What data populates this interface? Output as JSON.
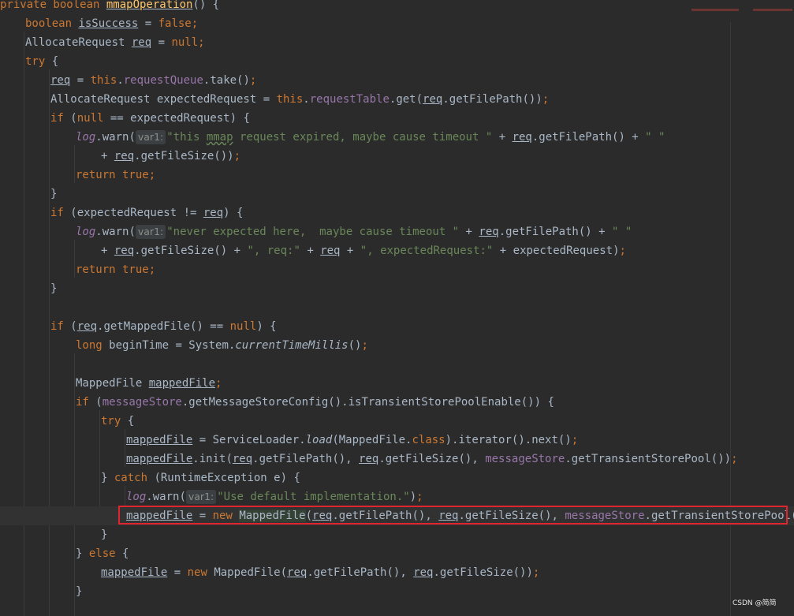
{
  "editor": {
    "code": {
      "l1_private": "private boolean ",
      "l1_method": "mmapOperation",
      "l1_rest": "() {",
      "l2_type": "boolean ",
      "l2_var": "isSuccess",
      "l2_eq": " = ",
      "l2_val": "false",
      "l2_semi": ";",
      "l3_type": "AllocateRequest ",
      "l3_var": "req",
      "l3_eq": " = ",
      "l3_val": "null",
      "l3_semi": ";",
      "l4_try": "try",
      "l4_brace": " {",
      "l5_var": "req",
      "l5_eq": " = ",
      "l5_this": "this",
      "l5_dot": ".",
      "l5_field": "requestQueue",
      "l5_rest": ".take()",
      "l5_semi": ";",
      "l6_decl": "AllocateRequest expectedRequest = ",
      "l6_this": "this",
      "l6_dot": ".",
      "l6_field": "requestTable",
      "l6_get": ".get(",
      "l6_req": "req",
      "l6_rest": ".getFilePath())",
      "l6_semi": ";",
      "l7_if": "if",
      "l7_open": " (",
      "l7_null": "null",
      "l7_rest": " == expectedRequest) {",
      "l8_log": "log",
      "l8_warn": ".warn(",
      "l8_hint": "var1:",
      "l8_str1": "\"this ",
      "l8_mmap": "mmap",
      "l8_str2": " request expired, maybe cause timeout \"",
      "l8_plus": " + ",
      "l8_req": "req",
      "l8_path": ".getFilePath() + ",
      "l8_str3": "\" \"",
      "l9_plus": "+ ",
      "l9_req": "req",
      "l9_rest": ".getFileSize())",
      "l9_semi": ";",
      "l10_return": "return true;",
      "l11_close": "}",
      "l12_if": "if",
      "l12_cond": " (expectedRequest != ",
      "l12_req": "req",
      "l12_rest": ") {",
      "l13_log": "log",
      "l13_warn": ".warn(",
      "l13_hint": "var1:",
      "l13_str1": "\"never expected here,  maybe cause timeout \"",
      "l13_plus": " + ",
      "l13_req": "req",
      "l13_path": ".getFilePath() + ",
      "l13_str2": "\" \"",
      "l14_plus": "+ ",
      "l14_req": "req",
      "l14_size": ".getFileSize() + ",
      "l14_str1": "\", req:\"",
      "l14_plus2": " + ",
      "l14_req2": "req",
      "l14_plus3": " + ",
      "l14_str2": "\", expectedRequest:\"",
      "l14_rest": " + expectedRequest)",
      "l14_semi": ";",
      "l15_return": "return true;",
      "l16_close": "}",
      "l18_if": "if",
      "l18_open": " (",
      "l18_req": "req",
      "l18_mid": ".getMappedFile() == ",
      "l18_null": "null",
      "l18_rest": ") {",
      "l19_long": "long ",
      "l19_mid": "beginTime = System.",
      "l19_call": "currentTimeMillis",
      "l19_rest": "()",
      "l19_semi": ";",
      "l21_type": "MappedFile ",
      "l21_var": "mappedFile",
      "l21_semi": ";",
      "l22_if": "if",
      "l22_open": " (",
      "l22_field": "messageStore",
      "l22_rest": ".getMessageStoreConfig().isTransientStorePoolEnable()) {",
      "l23_try": "try",
      "l23_brace": " {",
      "l24_var": "mappedFile",
      "l24_mid": " = ServiceLoader.",
      "l24_load": "load",
      "l24_arg": "(MappedFile.",
      "l24_class": "class",
      "l24_rest": ").iterator().next()",
      "l24_semi": ";",
      "l25_var": "mappedFile",
      "l25_init": ".init(",
      "l25_req": "req",
      "l25_path": ".getFilePath(), ",
      "l25_req2": "req",
      "l25_size": ".getFileSize(), ",
      "l25_field": "messageStore",
      "l25_rest": ".getTransientStorePool())",
      "l25_semi": ";",
      "l26_close": "} ",
      "l26_catch": "catch",
      "l26_rest": " (RuntimeException e) {",
      "l27_log": "log",
      "l27_warn": ".warn(",
      "l27_hint": "var1:",
      "l27_str": "\"Use default implementation.\"",
      "l27_rest": ")",
      "l27_semi": ";",
      "l28_var": "mappedFile",
      "l28_eq": " = ",
      "l28_new": "new ",
      "l28_ctor": "MappedFile",
      "l28_open": "(",
      "l28_req": "req",
      "l28_path": ".getFilePath(), ",
      "l28_req2": "req",
      "l28_size": ".getFileSize(), ",
      "l28_field": "messageStore",
      "l28_rest": ".getTransientStorePool())",
      "l28_semi": ";",
      "l29_close": "}",
      "l30_close": "} ",
      "l30_else": "else",
      "l30_brace": " {",
      "l31_var": "mappedFile",
      "l31_eq": " = ",
      "l31_new": "new ",
      "l31_ctor": "MappedFile(",
      "l31_req": "req",
      "l31_path": ".getFilePath(), ",
      "l31_req2": "req",
      "l31_rest": ".getFileSize())",
      "l31_semi": ";",
      "l32_close": "}"
    },
    "highlight_color": "#e1252f",
    "watermark": "CSDN @简简"
  }
}
